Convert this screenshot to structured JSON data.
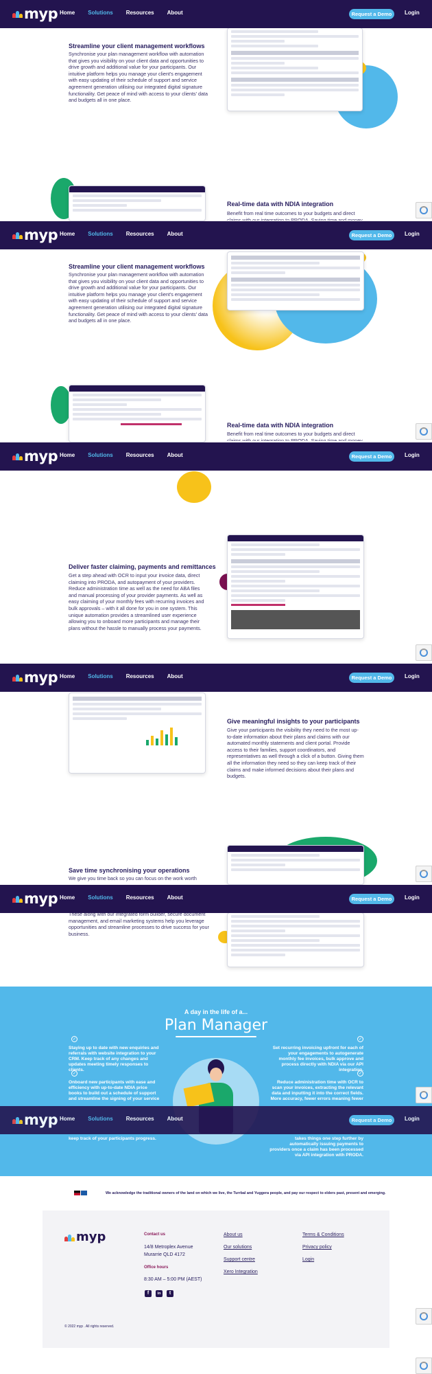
{
  "nav": {
    "logo_text": "myp",
    "links": [
      "Home",
      "Solutions",
      "Resources",
      "About"
    ],
    "active_link": "Solutions",
    "demo_button": "Request a Demo",
    "login": "Login"
  },
  "sections": {
    "streamline": {
      "heading": "Streamline your client management workflows",
      "body": "Synchronise your plan management workflow with automation that gives you visibility on your client data and opportunities to drive growth and additional value for your participants.  Our intuitive platform helps you manage your client's engagement with easy updating of their schedule of support and service agreement generation utilising our integrated digital signature functionality.  Get peace of mind with access to your clients' data and budgets all in one place."
    },
    "ndia": {
      "heading": "Real-time data with NDIA integration",
      "body_partial": "Benefit from real time outcomes to your budgets and direct claims with our integration to PRODA.  Saving time and money"
    },
    "claiming": {
      "heading": "Deliver faster claiming, payments and remittances",
      "body": "Get a step ahead with OCR to input your invoice data, direct claiming into PRODA, and autopayment of your providers.  Reduce administration time as well as the need for ABA files and manual processing of your provider payments. As well as easy claiming of your monthly fees with recurring invoices and bulk approvals – with it all done for you in one system.  This unique automation provides a streamlined user experience allowing you to onboard more participants and manage their plans without the hassle to manually process your payments."
    },
    "insights": {
      "heading": "Give meaningful insights to your participants",
      "body": "Give your participants the visibility they need to the most up-to-date information about their plans and claims with our automated monthly statements and client portal.  Provide access to their families, support coordinators, and representatives as well through a click of a button.  Giving them all the information they need so they can keep track of their claims and make informed decisions about their plans and budgets."
    },
    "operations": {
      "heading": "Save time synchronising your operations",
      "body_partial": "We give you time back so you can focus on the work worth",
      "body_rest": "These along with our integrated form builder, secure document management, and email marketing systems help you leverage opportunities and streamline processes to drive success for your business."
    }
  },
  "day_in_life": {
    "small_title": "A day in the life of a...",
    "title": "Plan Manager",
    "left": [
      "Staying up to date with new enquiries and referrals with website integration to your CRM. Keep track of any changes and updates meeting timely responses to clients.",
      "Onboard new participants with ease and efficiency with up-to-date NDIA price books to build out a schedule of support and streamline the signing of your service agreements utilising"
    ],
    "left_bottom": "keep track of your participants progress.",
    "right": [
      "Set recurring invoicing upfront for each of your engagements to autogenerate monthly fee invoices, bulk approve and process directly with NDIA via our API integration.",
      "Reduce administration time with OCR to scan your invoices, extracting the relevant data and inputting it into the correct fields.  More accuracy, fewer errors meaning fewer delays in"
    ],
    "right_bottom": "takes things one step further by automatically issuing payments to providers once a claim has been processed via API integration with PRODA."
  },
  "acknowledgement": "We acknowledge the traditional owners of the land on which we live, the Turrbal and Yuggera people, and pay our respect to elders past, present and emerging.",
  "footer": {
    "contact_heading": "Contact us",
    "address_line1": "14/8 Metroplex Avenue",
    "address_line2": "Murarrie QLD 4172",
    "hours_heading": "Office hours",
    "hours": "8:30 AM – 5:00 PM (AEST)",
    "links_col1": [
      "About us",
      "Our solutions",
      "Support centre",
      "Xero Integration"
    ],
    "links_col2": [
      "Terms & Conditions",
      "Privacy policy",
      "Login"
    ],
    "social": [
      "f",
      "in",
      "t"
    ],
    "copyright": "© 2022 myp . All rights reserved."
  },
  "colors": {
    "navy": "#23144f",
    "sky": "#52b8ea",
    "yellow": "#f7c21a",
    "green": "#1aa86b",
    "plum": "#7a1050"
  }
}
